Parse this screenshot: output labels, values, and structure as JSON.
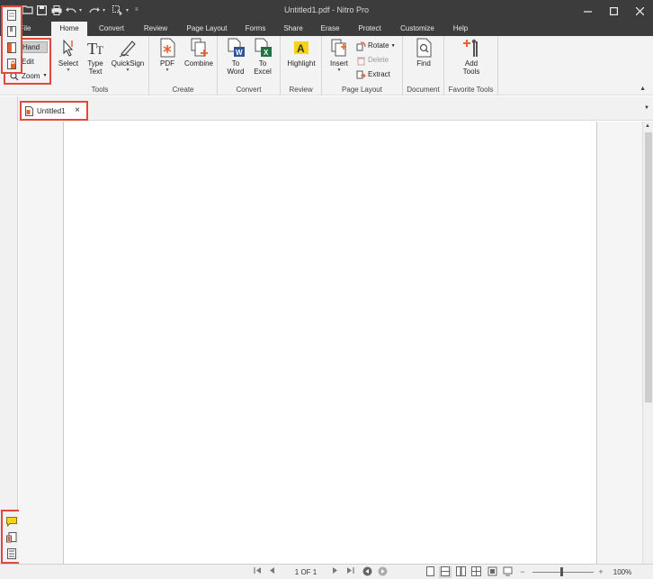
{
  "window": {
    "title": "Untitled1.pdf - Nitro Pro",
    "controls": [
      "minimize-icon",
      "maximize-icon",
      "close-icon"
    ]
  },
  "quick_access": {
    "icons": [
      "open-folder-icon",
      "save-icon",
      "print-icon",
      "undo-icon",
      "redo-icon",
      "select-tool-icon",
      "customize-qat-icon"
    ]
  },
  "ribbon": {
    "tabs": [
      {
        "label": "File"
      },
      {
        "label": "Home"
      },
      {
        "label": "Convert"
      },
      {
        "label": "Review"
      },
      {
        "label": "Page Layout"
      },
      {
        "label": "Forms"
      },
      {
        "label": "Share"
      },
      {
        "label": "Erase"
      },
      {
        "label": "Protect"
      },
      {
        "label": "Customize"
      },
      {
        "label": "Help"
      }
    ],
    "active_tab": "Home",
    "modes": {
      "hand": "Hand",
      "edit": "Edit",
      "zoom": "Zoom"
    },
    "groups": {
      "tools": {
        "label": "Tools",
        "select": "Select",
        "type_text": "Type\nText",
        "quicksign": "QuickSign"
      },
      "create": {
        "label": "Create",
        "pdf": "PDF",
        "combine": "Combine"
      },
      "convert": {
        "label": "Convert",
        "to_word": "To\nWord",
        "to_excel": "To\nExcel"
      },
      "review": {
        "label": "Review",
        "highlight": "Highlight"
      },
      "page_layout": {
        "label": "Page Layout",
        "insert": "Insert",
        "rotate": "Rotate",
        "delete": "Delete",
        "extract": "Extract"
      },
      "document": {
        "label": "Document",
        "find": "Find"
      },
      "favorite_tools": {
        "label": "Favorite Tools",
        "add_tools": "Add\nTools"
      }
    }
  },
  "document": {
    "tab_label": "Untitled1"
  },
  "statusbar": {
    "page_indicator": "1 OF 1",
    "zoom_level": "100%",
    "zoom_fraction": 0.46
  },
  "colors": {
    "accent": "#e04a3c",
    "titlebar": "#3c3c3c",
    "ribbon": "#f3f3f3"
  }
}
